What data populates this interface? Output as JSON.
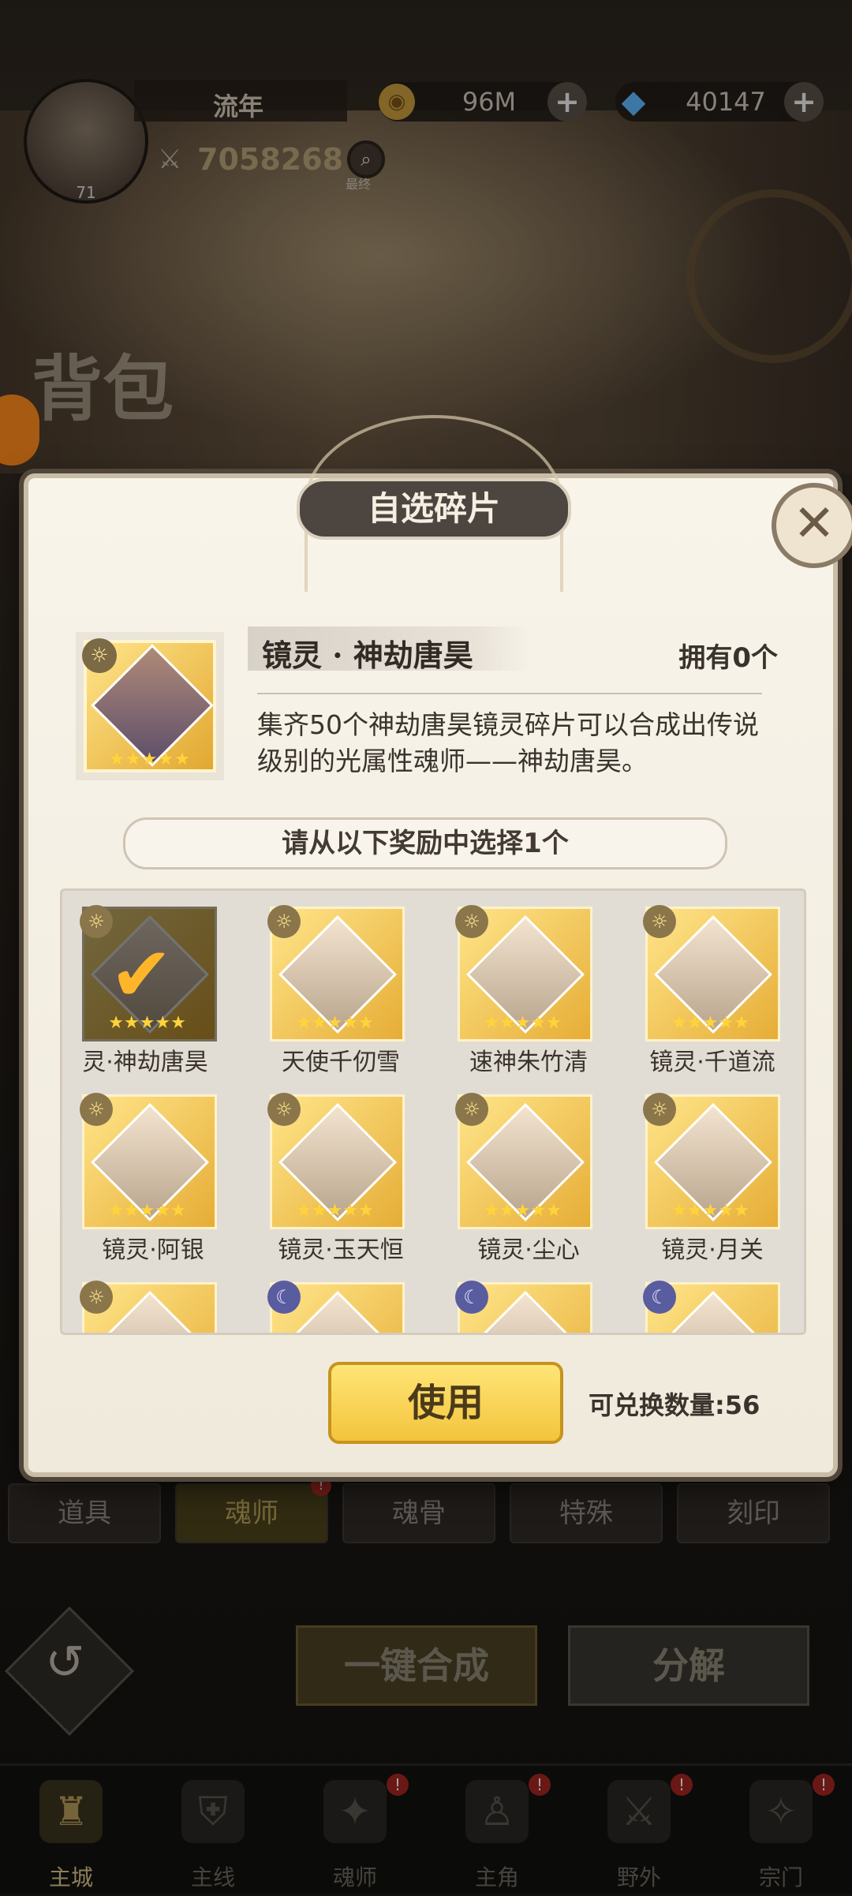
{
  "hud": {
    "player_name": "流年",
    "level": "71",
    "coins": "96M",
    "gems": "40147",
    "power": "7058268",
    "search_label": "最终"
  },
  "background": {
    "page_title": "背包"
  },
  "modal": {
    "title": "自选碎片",
    "fragment": {
      "name": "镜灵 · 神劫唐昊",
      "owned": "拥有0个",
      "description": "集齐50个神劫唐昊镜灵碎片可以合成出传说级别的光属性魂师——神劫唐昊。",
      "stars": "★★★★★"
    },
    "choose_label": "请从以下奖励中选择1个",
    "items": [
      {
        "name": "灵·神劫唐昊",
        "stars": "★★★★★",
        "badge": "sun",
        "selected": true
      },
      {
        "name": "天使千仞雪",
        "stars": "★★★★★",
        "badge": "sun"
      },
      {
        "name": "速神朱竹清",
        "stars": "★★★★★",
        "badge": "sun"
      },
      {
        "name": "镜灵·千道流",
        "stars": "★★★★★",
        "badge": "sun"
      },
      {
        "name": "镜灵·阿银",
        "stars": "★★★★★",
        "badge": "sun"
      },
      {
        "name": "镜灵·玉天恒",
        "stars": "★★★★★",
        "badge": "sun"
      },
      {
        "name": "镜灵·尘心",
        "stars": "★★★★★",
        "badge": "sun"
      },
      {
        "name": "镜灵·月关",
        "stars": "★★★★★",
        "badge": "sun"
      },
      {
        "name": "",
        "stars": "",
        "badge": "sun"
      },
      {
        "name": "",
        "stars": "",
        "badge": "moon"
      },
      {
        "name": "",
        "stars": "",
        "badge": "moon"
      },
      {
        "name": "",
        "stars": "",
        "badge": "moon"
      }
    ],
    "use_label": "使用",
    "exchange_label": "可兑换数量:56"
  },
  "categories": [
    {
      "label": "道具"
    },
    {
      "label": "魂师",
      "active": true,
      "alert": "!"
    },
    {
      "label": "魂骨"
    },
    {
      "label": "特殊"
    },
    {
      "label": "刻印"
    }
  ],
  "actions": {
    "merge_label": "一键合成",
    "split_label": "分解",
    "back_icon": "↺"
  },
  "bottom_nav": [
    {
      "label": "主城",
      "icon": "castle-icon",
      "active": true
    },
    {
      "label": "主线",
      "icon": "shield-icon"
    },
    {
      "label": "魂师",
      "icon": "soul-master-icon",
      "alert": "!"
    },
    {
      "label": "主角",
      "icon": "hero-icon",
      "alert": "!"
    },
    {
      "label": "野外",
      "icon": "wild-icon",
      "alert": "!"
    },
    {
      "label": "宗门",
      "icon": "sect-icon",
      "alert": "!"
    }
  ],
  "colors": {
    "accent_gold": "#f3c43c",
    "modal_bg": "#f0eadc",
    "alert_red": "#b52b26"
  }
}
